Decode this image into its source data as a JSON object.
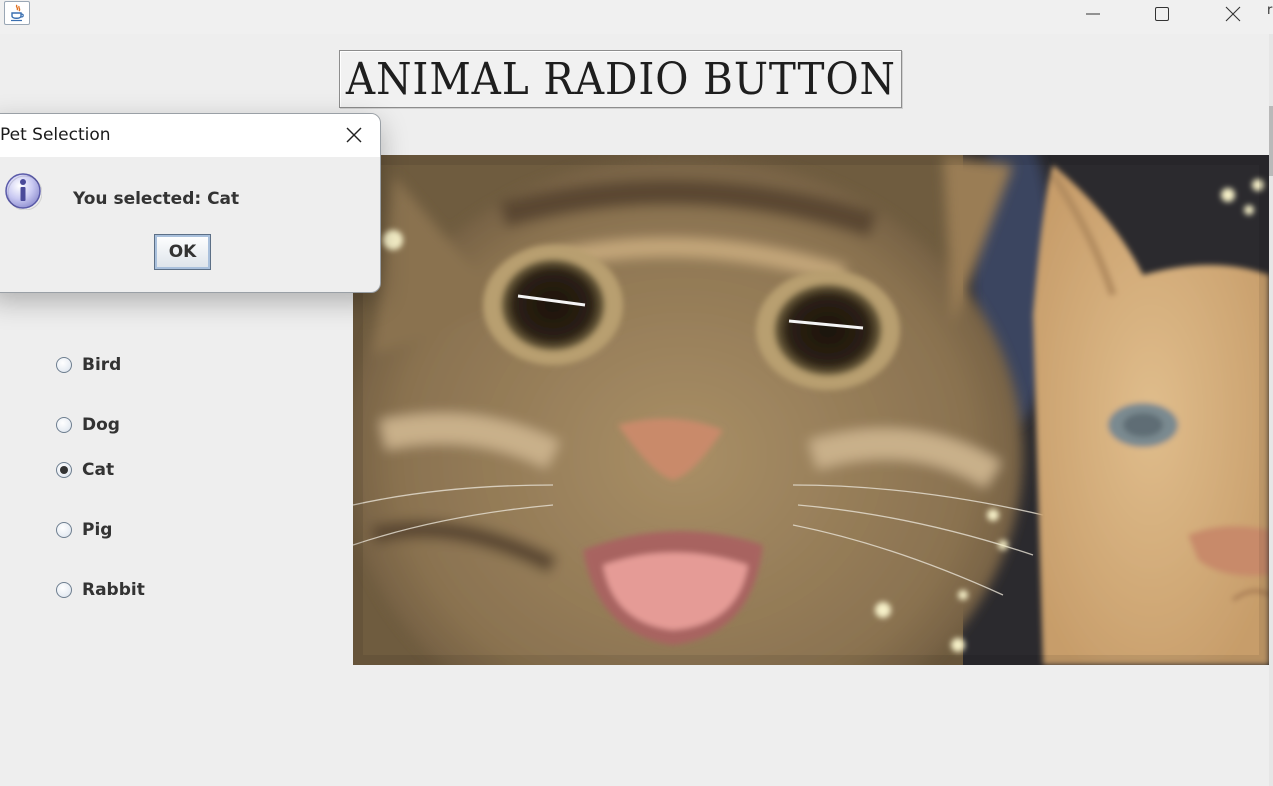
{
  "window": {
    "icon": "java-cup-icon",
    "controls": {
      "minimize": "minimize-icon",
      "maximize": "maximize-icon",
      "close": "close-icon"
    },
    "edge_char": "r"
  },
  "banner": {
    "title": "ANIMAL RADIO BUTTON"
  },
  "radio_group": {
    "options": [
      {
        "label": "Bird",
        "checked": false
      },
      {
        "label": "Dog",
        "checked": false
      },
      {
        "label": "Cat",
        "checked": true
      },
      {
        "label": "Pig",
        "checked": false
      },
      {
        "label": "Rabbit",
        "checked": false
      }
    ]
  },
  "photo": {
    "subject": "cats"
  },
  "dialog": {
    "title": "Pet Selection",
    "message": "You selected: Cat",
    "ok_label": "OK",
    "icon": "info-icon"
  }
}
